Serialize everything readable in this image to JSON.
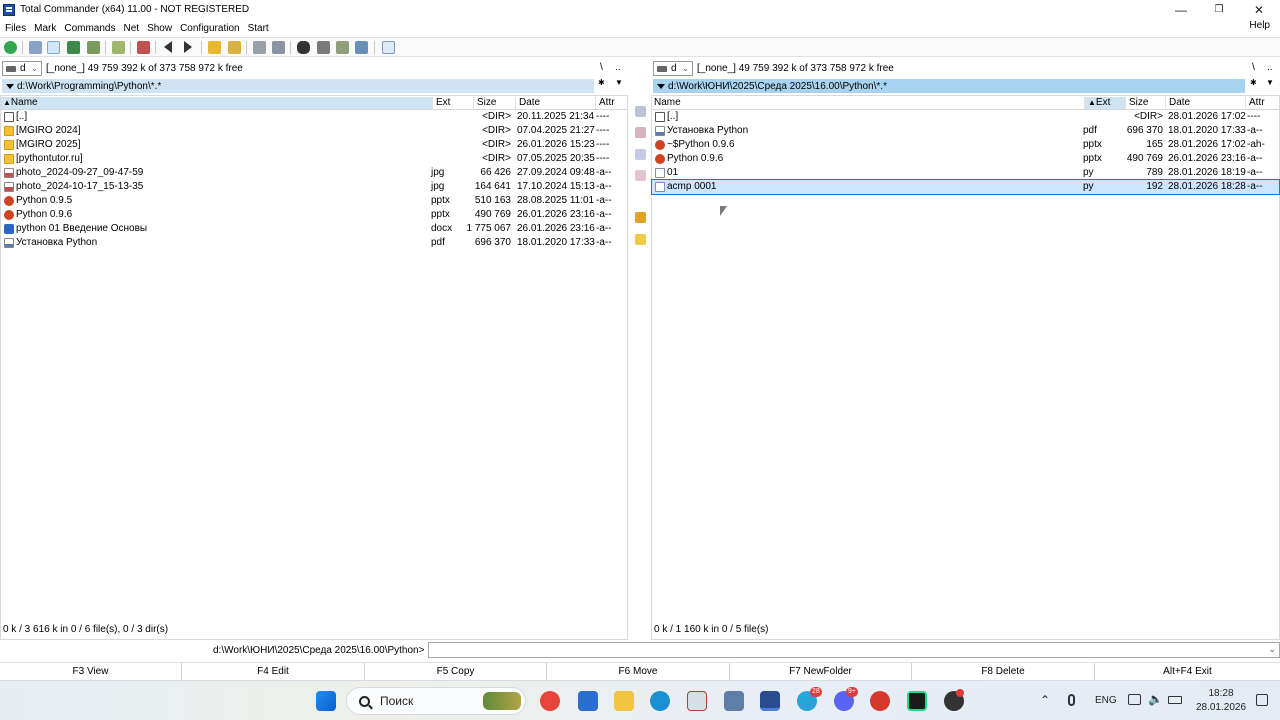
{
  "window": {
    "title": "Total Commander (x64) 11.00 - NOT REGISTERED",
    "minimize": "—",
    "restore": "❐",
    "close": "✕"
  },
  "menu": {
    "items": [
      "Files",
      "Mark",
      "Commands",
      "Net",
      "Show",
      "Configuration",
      "Start"
    ],
    "help": "Help"
  },
  "left_panel": {
    "drive": "d",
    "free_info": "[_none_]  49 759 392 k of 373 758 972 k free",
    "root_btn": "\\",
    "up_btn": "..",
    "path": "d:\\Work\\Programming\\Python\\*.*",
    "columns": {
      "name": "Name",
      "ext": "Ext",
      "size": "Size",
      "date": "Date",
      "attr": "Attr"
    },
    "rows": [
      {
        "name": "[..]",
        "ext": "",
        "size": "<DIR>",
        "date": "20.11.2025 21:34",
        "attr": "----",
        "icon": "up-dir-icon"
      },
      {
        "name": "[MGIRO 2024]",
        "ext": "",
        "size": "<DIR>",
        "date": "07.04.2025 21:27",
        "attr": "----",
        "icon": "folder-icon"
      },
      {
        "name": "[MGIRO 2025]",
        "ext": "",
        "size": "<DIR>",
        "date": "26.01.2026 15:23",
        "attr": "----",
        "icon": "folder-icon"
      },
      {
        "name": "[pythontutor.ru]",
        "ext": "",
        "size": "<DIR>",
        "date": "07.05.2025 20:35",
        "attr": "----",
        "icon": "folder-icon"
      },
      {
        "name": "photo_2024-09-27_09-47-59",
        "ext": "jpg",
        "size": "66 426",
        "date": "27.09.2024 09:48",
        "attr": "-a--",
        "icon": "image-file-icon"
      },
      {
        "name": "photo_2024-10-17_15-13-35",
        "ext": "jpg",
        "size": "164 641",
        "date": "17.10.2024 15:13",
        "attr": "-a--",
        "icon": "image-file-icon"
      },
      {
        "name": "Python 0.9.5",
        "ext": "pptx",
        "size": "510 163",
        "date": "28.08.2025 11:01",
        "attr": "-a--",
        "icon": "powerpoint-file-icon"
      },
      {
        "name": "Python 0.9.6",
        "ext": "pptx",
        "size": "490 769",
        "date": "26.01.2026 23:16",
        "attr": "-a--",
        "icon": "powerpoint-file-icon"
      },
      {
        "name": "python 01 Введение Основы",
        "ext": "docx",
        "size": "1 775 067",
        "date": "26.01.2026 23:16",
        "attr": "-a--",
        "icon": "word-file-icon"
      },
      {
        "name": "Установка Python",
        "ext": "pdf",
        "size": "696 370",
        "date": "18.01.2020 17:33",
        "attr": "-a--",
        "icon": "pdf-file-icon"
      }
    ],
    "status": "0 k / 3 616 k in 0 / 6 file(s), 0 / 3 dir(s)"
  },
  "right_panel": {
    "drive": "d",
    "free_info": "[_none_]  49 759 392 k of 373 758 972 k free",
    "root_btn": "\\",
    "up_btn": "..",
    "path": "d:\\Work\\ЮНИ\\2025\\Среда 2025\\16.00\\Python\\*.*",
    "columns": {
      "name": "Name",
      "ext": "Ext",
      "size": "Size",
      "date": "Date",
      "attr": "Attr"
    },
    "rows": [
      {
        "name": "[..]",
        "ext": "",
        "size": "<DIR>",
        "date": "28.01.2026 17:02",
        "attr": "----",
        "icon": "up-dir-icon"
      },
      {
        "name": "Установка Python",
        "ext": "pdf",
        "size": "696 370",
        "date": "18.01.2020 17:33",
        "attr": "-a--",
        "icon": "pdf-file-icon"
      },
      {
        "name": "~$Python 0.9.6",
        "ext": "pptx",
        "size": "165",
        "date": "28.01.2026 17:02",
        "attr": "-ah-",
        "icon": "powerpoint-file-icon"
      },
      {
        "name": "Python 0.9.6",
        "ext": "pptx",
        "size": "490 769",
        "date": "26.01.2026 23:16",
        "attr": "-a--",
        "icon": "powerpoint-file-icon"
      },
      {
        "name": "01",
        "ext": "py",
        "size": "789",
        "date": "28.01.2026 18:19",
        "attr": "-a--",
        "icon": "python-file-icon"
      },
      {
        "name": "acmp 0001",
        "ext": "py",
        "size": "192",
        "date": "28.01.2026 18:28",
        "attr": "-a--",
        "icon": "python-file-icon"
      }
    ],
    "status": "0 k / 1 160 k in 0 / 5 file(s)"
  },
  "command_line": {
    "prompt": "d:\\Work\\ЮНИ\\2025\\Среда 2025\\16.00\\Python>",
    "value": ""
  },
  "function_keys": [
    "F3 View",
    "F4 Edit",
    "F5 Copy",
    "F6 Move",
    "F7 NewFolder",
    "F8 Delete",
    "Alt+F4 Exit"
  ],
  "taskbar": {
    "search_placeholder": "Поиск",
    "language": "ENG",
    "time": "18:28",
    "date": "28.01.2026",
    "telegram_badge": "28",
    "discord_badge": "9+"
  },
  "colors": {
    "selected_row": "#cce6ff",
    "active_path_bar": "#a8d3f0",
    "inactive_path_bar": "#cfe3f2"
  }
}
